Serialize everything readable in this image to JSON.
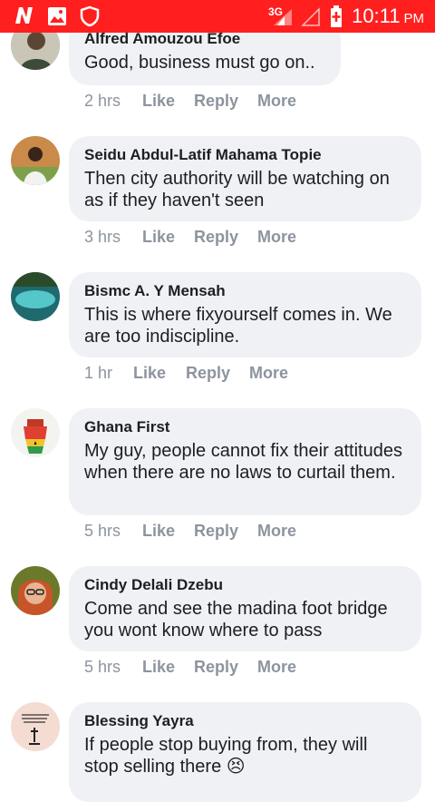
{
  "status_bar": {
    "network": "3G",
    "time": "10:11",
    "ampm": "PM",
    "icons": [
      "notification-n-icon",
      "gallery-icon",
      "shield-icon",
      "signal-icon",
      "no-signal-icon",
      "battery-icon"
    ]
  },
  "actions": {
    "like": "Like",
    "reply": "Reply",
    "more": "More"
  },
  "comments": [
    {
      "author": "Alfred Amouzou Efoe",
      "text": "Good, business must go on..",
      "time": "2 hrs"
    },
    {
      "author": "Seidu Abdul-Latif Mahama Topie",
      "text": "Then city authority will be watching on as if they haven't seen",
      "time": "3 hrs"
    },
    {
      "author": "Bismc A. Y Mensah",
      "text": "This is where fixyourself comes in. We are too indiscipline.",
      "time": "1 hr"
    },
    {
      "author": "Ghana First",
      "text": "My guy, people cannot fix their attitudes when there are no laws to curtail them.",
      "time": "5 hrs"
    },
    {
      "author": "Cindy Delali Dzebu",
      "text": "Come and see the madina foot bridge you wont know where to pass",
      "time": "5 hrs"
    },
    {
      "author": "Blessing Yayra",
      "text": "If people stop buying from, they will stop selling there 😣",
      "time": ""
    }
  ],
  "colors": {
    "status_bar": "#ff1f1f",
    "bubble": "#f0f1f5",
    "meta_text": "#8d949e"
  }
}
